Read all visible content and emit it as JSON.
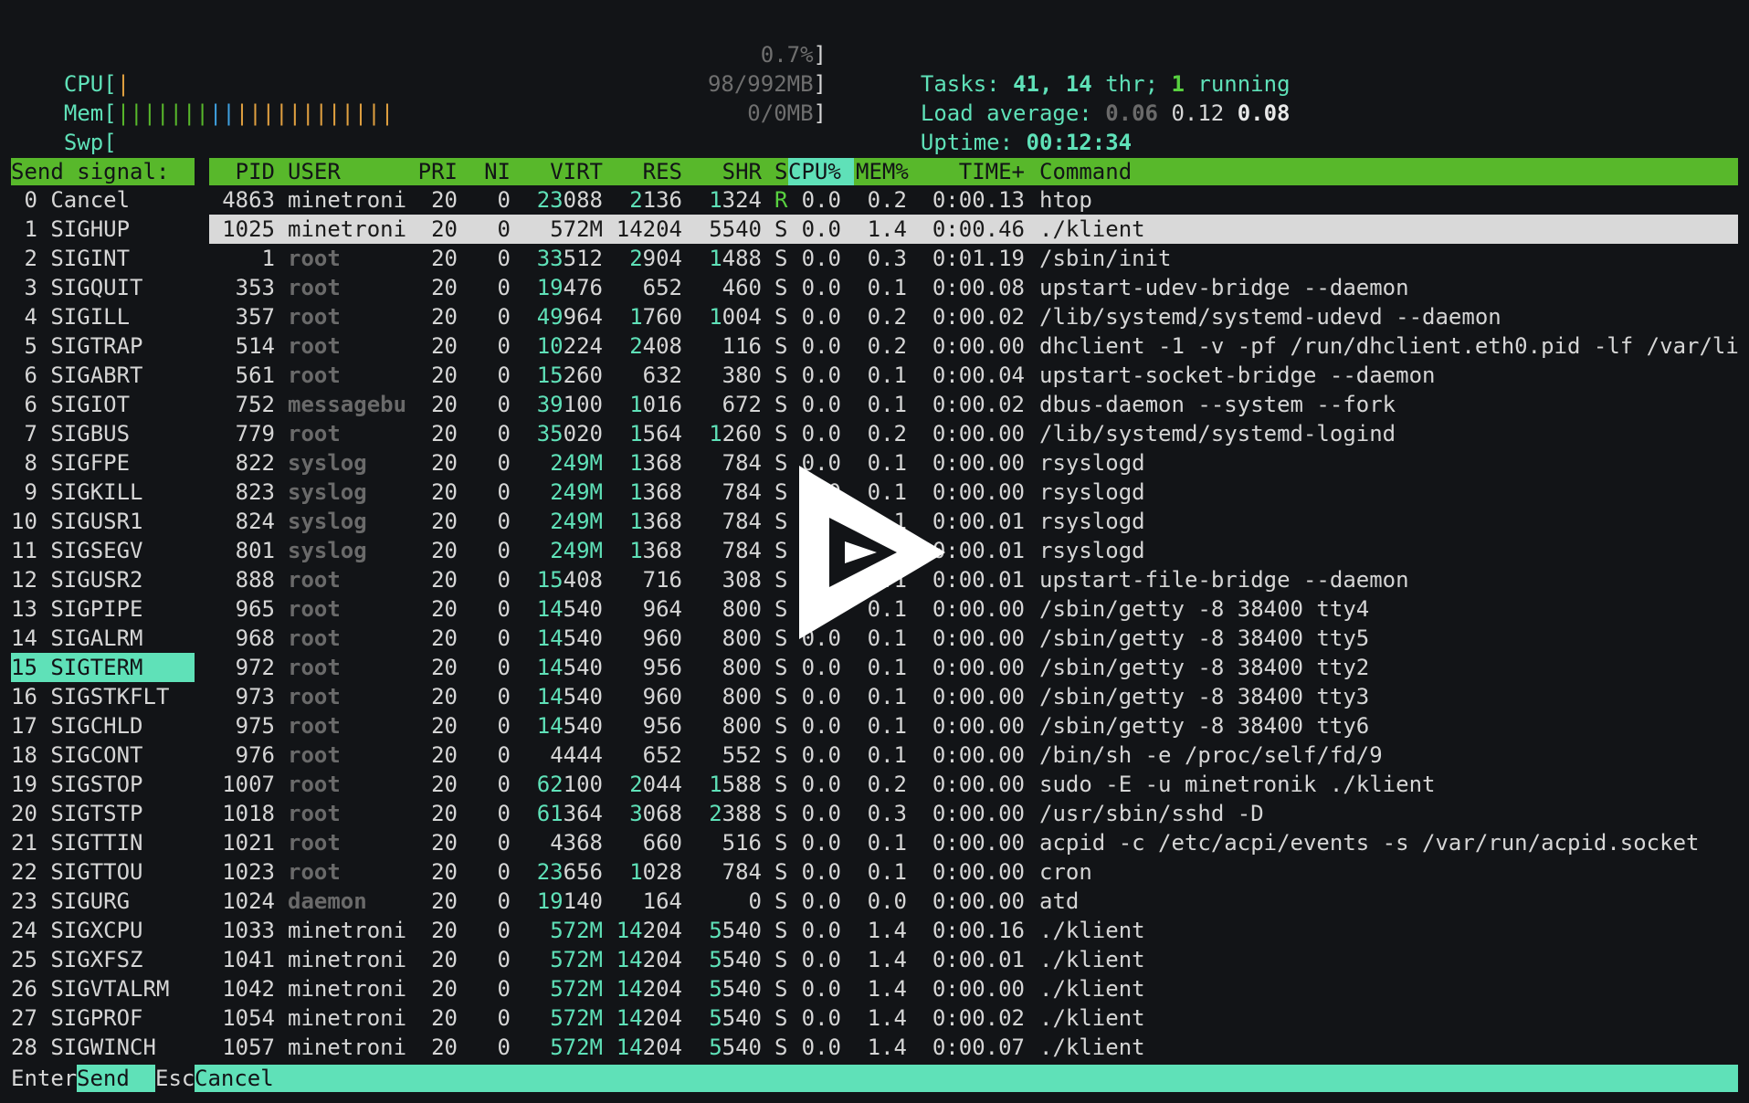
{
  "meters": {
    "cpu": {
      "label": "CPU[",
      "value": "0.7%",
      "end": "]"
    },
    "mem": {
      "label": "Mem[",
      "value": "98/992MB",
      "end": "]"
    },
    "swp": {
      "label": "Swp[",
      "value": "0/0MB",
      "end": "]"
    }
  },
  "stats": {
    "tasks_label": "Tasks: ",
    "tasks_value": "41, 14",
    "thr_label": " thr; ",
    "running_value": "1",
    "running_label": " running",
    "load_label": "Load average: ",
    "load_1": "0.06",
    "load_5": "0.12",
    "load_15": "0.08",
    "uptime_label": "Uptime: ",
    "uptime_value": "00:12:34"
  },
  "signal_panel": {
    "title": "Send signal:",
    "items": [
      " 0 Cancel",
      " 1 SIGHUP",
      " 2 SIGINT",
      " 3 SIGQUIT",
      " 4 SIGILL",
      " 5 SIGTRAP",
      " 6 SIGABRT",
      " 6 SIGIOT",
      " 7 SIGBUS",
      " 8 SIGFPE",
      " 9 SIGKILL",
      "10 SIGUSR1",
      "11 SIGSEGV",
      "12 SIGUSR2",
      "13 SIGPIPE",
      "14 SIGALRM",
      "15 SIGTERM",
      "16 SIGSTKFLT",
      "17 SIGCHLD",
      "18 SIGCONT",
      "19 SIGSTOP",
      "20 SIGTSTP",
      "21 SIGTTIN",
      "22 SIGTTOU",
      "23 SIGURG",
      "24 SIGXCPU",
      "25 SIGXFSZ",
      "26 SIGVTALRM",
      "27 SIGPROF",
      "28 SIGWINCH"
    ],
    "selected": "15 SIGTERM"
  },
  "table": {
    "headers": {
      "pid": "PID",
      "user": "USER",
      "pri": "PRI",
      "ni": "NI",
      "virt": "VIRT",
      "res": "RES",
      "shr": "SHR",
      "s": "S",
      "cpu": "CPU%",
      "mem": "MEM%",
      "time": "TIME+",
      "command": "Command"
    },
    "rows": [
      {
        "pid": "4863",
        "user": "minetroni",
        "pri": "20",
        "ni": "0",
        "virt_a": "23",
        "virt_b": "088",
        "res_a": "2",
        "res_b": "136",
        "shr_a": "1",
        "shr_b": "324",
        "s": "R",
        "cpu": "0.0",
        "mem": "0.2",
        "time": "0:00.13",
        "command": "htop"
      },
      {
        "pid": "1025",
        "user": "minetroni",
        "pri": "20",
        "ni": "0",
        "virt_a": "",
        "virt_b": "572M",
        "res_a": "",
        "res_b": "14204",
        "shr_a": "",
        "shr_b": "5540",
        "s": "S",
        "cpu": "0.0",
        "mem": "1.4",
        "time": "0:00.46",
        "command": "./klient",
        "highlight": true
      },
      {
        "pid": "1",
        "user": "root",
        "pri": "20",
        "ni": "0",
        "virt_a": "33",
        "virt_b": "512",
        "res_a": "2",
        "res_b": "904",
        "shr_a": "1",
        "shr_b": "488",
        "s": "S",
        "cpu": "0.0",
        "mem": "0.3",
        "time": "0:01.19",
        "command": "/sbin/init"
      },
      {
        "pid": "353",
        "user": "root",
        "pri": "20",
        "ni": "0",
        "virt_a": "19",
        "virt_b": "476",
        "res_a": "",
        "res_b": "652",
        "shr_a": "",
        "shr_b": "460",
        "s": "S",
        "cpu": "0.0",
        "mem": "0.1",
        "time": "0:00.08",
        "command": "upstart-udev-bridge --daemon"
      },
      {
        "pid": "357",
        "user": "root",
        "pri": "20",
        "ni": "0",
        "virt_a": "49",
        "virt_b": "964",
        "res_a": "1",
        "res_b": "760",
        "shr_a": "1",
        "shr_b": "004",
        "s": "S",
        "cpu": "0.0",
        "mem": "0.2",
        "time": "0:00.02",
        "command": "/lib/systemd/systemd-udevd --daemon"
      },
      {
        "pid": "514",
        "user": "root",
        "pri": "20",
        "ni": "0",
        "virt_a": "10",
        "virt_b": "224",
        "res_a": "2",
        "res_b": "408",
        "shr_a": "",
        "shr_b": "116",
        "s": "S",
        "cpu": "0.0",
        "mem": "0.2",
        "time": "0:00.00",
        "command": "dhclient -1 -v -pf /run/dhclient.eth0.pid -lf /var/li"
      },
      {
        "pid": "561",
        "user": "root",
        "pri": "20",
        "ni": "0",
        "virt_a": "15",
        "virt_b": "260",
        "res_a": "",
        "res_b": "632",
        "shr_a": "",
        "shr_b": "380",
        "s": "S",
        "cpu": "0.0",
        "mem": "0.1",
        "time": "0:00.04",
        "command": "upstart-socket-bridge --daemon"
      },
      {
        "pid": "752",
        "user": "messagebu",
        "pri": "20",
        "ni": "0",
        "virt_a": "39",
        "virt_b": "100",
        "res_a": "1",
        "res_b": "016",
        "shr_a": "",
        "shr_b": "672",
        "s": "S",
        "cpu": "0.0",
        "mem": "0.1",
        "time": "0:00.02",
        "command": "dbus-daemon --system --fork"
      },
      {
        "pid": "779",
        "user": "root",
        "pri": "20",
        "ni": "0",
        "virt_a": "35",
        "virt_b": "020",
        "res_a": "1",
        "res_b": "564",
        "shr_a": "1",
        "shr_b": "260",
        "s": "S",
        "cpu": "0.0",
        "mem": "0.2",
        "time": "0:00.00",
        "command": "/lib/systemd/systemd-logind"
      },
      {
        "pid": "822",
        "user": "syslog",
        "pri": "20",
        "ni": "0",
        "virt_a": "",
        "virt_b": "249M",
        "res_a": "1",
        "res_b": "368",
        "shr_a": "",
        "shr_b": "784",
        "s": "S",
        "cpu": "0.0",
        "mem": "0.1",
        "time": "0:00.00",
        "command": "rsyslogd"
      },
      {
        "pid": "823",
        "user": "syslog",
        "pri": "20",
        "ni": "0",
        "virt_a": "",
        "virt_b": "249M",
        "res_a": "1",
        "res_b": "368",
        "shr_a": "",
        "shr_b": "784",
        "s": "S",
        "cpu": "0.0",
        "mem": "0.1",
        "time": "0:00.00",
        "command": "rsyslogd"
      },
      {
        "pid": "824",
        "user": "syslog",
        "pri": "20",
        "ni": "0",
        "virt_a": "",
        "virt_b": "249M",
        "res_a": "1",
        "res_b": "368",
        "shr_a": "",
        "shr_b": "784",
        "s": "S",
        "cpu": "0.0",
        "mem": "0.1",
        "time": "0:00.01",
        "command": "rsyslogd"
      },
      {
        "pid": "801",
        "user": "syslog",
        "pri": "20",
        "ni": "0",
        "virt_a": "",
        "virt_b": "249M",
        "res_a": "1",
        "res_b": "368",
        "shr_a": "",
        "shr_b": "784",
        "s": "S",
        "cpu": "0.0",
        "mem": "0.1",
        "time": "0:00.01",
        "command": "rsyslogd"
      },
      {
        "pid": "888",
        "user": "root",
        "pri": "20",
        "ni": "0",
        "virt_a": "15",
        "virt_b": "408",
        "res_a": "",
        "res_b": "716",
        "shr_a": "",
        "shr_b": "308",
        "s": "S",
        "cpu": "0.0",
        "mem": "0.1",
        "time": "0:00.01",
        "command": "upstart-file-bridge --daemon"
      },
      {
        "pid": "965",
        "user": "root",
        "pri": "20",
        "ni": "0",
        "virt_a": "14",
        "virt_b": "540",
        "res_a": "",
        "res_b": "964",
        "shr_a": "",
        "shr_b": "800",
        "s": "S",
        "cpu": "0.0",
        "mem": "0.1",
        "time": "0:00.00",
        "command": "/sbin/getty -8 38400 tty4"
      },
      {
        "pid": "968",
        "user": "root",
        "pri": "20",
        "ni": "0",
        "virt_a": "14",
        "virt_b": "540",
        "res_a": "",
        "res_b": "960",
        "shr_a": "",
        "shr_b": "800",
        "s": "S",
        "cpu": "0.0",
        "mem": "0.1",
        "time": "0:00.00",
        "command": "/sbin/getty -8 38400 tty5"
      },
      {
        "pid": "972",
        "user": "root",
        "pri": "20",
        "ni": "0",
        "virt_a": "14",
        "virt_b": "540",
        "res_a": "",
        "res_b": "956",
        "shr_a": "",
        "shr_b": "800",
        "s": "S",
        "cpu": "0.0",
        "mem": "0.1",
        "time": "0:00.00",
        "command": "/sbin/getty -8 38400 tty2"
      },
      {
        "pid": "973",
        "user": "root",
        "pri": "20",
        "ni": "0",
        "virt_a": "14",
        "virt_b": "540",
        "res_a": "",
        "res_b": "960",
        "shr_a": "",
        "shr_b": "800",
        "s": "S",
        "cpu": "0.0",
        "mem": "0.1",
        "time": "0:00.00",
        "command": "/sbin/getty -8 38400 tty3"
      },
      {
        "pid": "975",
        "user": "root",
        "pri": "20",
        "ni": "0",
        "virt_a": "14",
        "virt_b": "540",
        "res_a": "",
        "res_b": "956",
        "shr_a": "",
        "shr_b": "800",
        "s": "S",
        "cpu": "0.0",
        "mem": "0.1",
        "time": "0:00.00",
        "command": "/sbin/getty -8 38400 tty6"
      },
      {
        "pid": "976",
        "user": "root",
        "pri": "20",
        "ni": "0",
        "virt_a": "",
        "virt_b": "4444",
        "res_a": "",
        "res_b": "652",
        "shr_a": "",
        "shr_b": "552",
        "s": "S",
        "cpu": "0.0",
        "mem": "0.1",
        "time": "0:00.00",
        "command": "/bin/sh -e /proc/self/fd/9"
      },
      {
        "pid": "1007",
        "user": "root",
        "pri": "20",
        "ni": "0",
        "virt_a": "62",
        "virt_b": "100",
        "res_a": "2",
        "res_b": "044",
        "shr_a": "1",
        "shr_b": "588",
        "s": "S",
        "cpu": "0.0",
        "mem": "0.2",
        "time": "0:00.00",
        "command": "sudo -E -u minetronik ./klient"
      },
      {
        "pid": "1018",
        "user": "root",
        "pri": "20",
        "ni": "0",
        "virt_a": "61",
        "virt_b": "364",
        "res_a": "3",
        "res_b": "068",
        "shr_a": "2",
        "shr_b": "388",
        "s": "S",
        "cpu": "0.0",
        "mem": "0.3",
        "time": "0:00.00",
        "command": "/usr/sbin/sshd -D"
      },
      {
        "pid": "1021",
        "user": "root",
        "pri": "20",
        "ni": "0",
        "virt_a": "",
        "virt_b": "4368",
        "res_a": "",
        "res_b": "660",
        "shr_a": "",
        "shr_b": "516",
        "s": "S",
        "cpu": "0.0",
        "mem": "0.1",
        "time": "0:00.00",
        "command": "acpid -c /etc/acpi/events -s /var/run/acpid.socket"
      },
      {
        "pid": "1023",
        "user": "root",
        "pri": "20",
        "ni": "0",
        "virt_a": "23",
        "virt_b": "656",
        "res_a": "1",
        "res_b": "028",
        "shr_a": "",
        "shr_b": "784",
        "s": "S",
        "cpu": "0.0",
        "mem": "0.1",
        "time": "0:00.00",
        "command": "cron"
      },
      {
        "pid": "1024",
        "user": "daemon",
        "pri": "20",
        "ni": "0",
        "virt_a": "19",
        "virt_b": "140",
        "res_a": "",
        "res_b": "164",
        "shr_a": "",
        "shr_b": "0",
        "s": "S",
        "cpu": "0.0",
        "mem": "0.0",
        "time": "0:00.00",
        "command": "atd"
      },
      {
        "pid": "1033",
        "user": "minetroni",
        "pri": "20",
        "ni": "0",
        "virt_a": "",
        "virt_b": "572M",
        "res_a": "14",
        "res_b": "204",
        "shr_a": "5",
        "shr_b": "540",
        "s": "S",
        "cpu": "0.0",
        "mem": "1.4",
        "time": "0:00.16",
        "command": "./klient"
      },
      {
        "pid": "1041",
        "user": "minetroni",
        "pri": "20",
        "ni": "0",
        "virt_a": "",
        "virt_b": "572M",
        "res_a": "14",
        "res_b": "204",
        "shr_a": "5",
        "shr_b": "540",
        "s": "S",
        "cpu": "0.0",
        "mem": "1.4",
        "time": "0:00.01",
        "command": "./klient"
      },
      {
        "pid": "1042",
        "user": "minetroni",
        "pri": "20",
        "ni": "0",
        "virt_a": "",
        "virt_b": "572M",
        "res_a": "14",
        "res_b": "204",
        "shr_a": "5",
        "shr_b": "540",
        "s": "S",
        "cpu": "0.0",
        "mem": "1.4",
        "time": "0:00.00",
        "command": "./klient"
      },
      {
        "pid": "1054",
        "user": "minetroni",
        "pri": "20",
        "ni": "0",
        "virt_a": "",
        "virt_b": "572M",
        "res_a": "14",
        "res_b": "204",
        "shr_a": "5",
        "shr_b": "540",
        "s": "S",
        "cpu": "0.0",
        "mem": "1.4",
        "time": "0:00.02",
        "command": "./klient"
      },
      {
        "pid": "1057",
        "user": "minetroni",
        "pri": "20",
        "ni": "0",
        "virt_a": "",
        "virt_b": "572M",
        "res_a": "14",
        "res_b": "204",
        "shr_a": "5",
        "shr_b": "540",
        "s": "S",
        "cpu": "0.0",
        "mem": "1.4",
        "time": "0:00.07",
        "command": "./klient"
      }
    ]
  },
  "footer": {
    "enter_key": "Enter",
    "send_label": "Send  ",
    "esc_key": "Esc",
    "cancel_label": "Cancel"
  },
  "colors": {
    "background": "#121417",
    "header_green": "#58b82b",
    "accent_teal": "#5fe1b8",
    "highlight_row": "#d9d9d9"
  },
  "icons": {
    "overlay": "play-icon"
  }
}
